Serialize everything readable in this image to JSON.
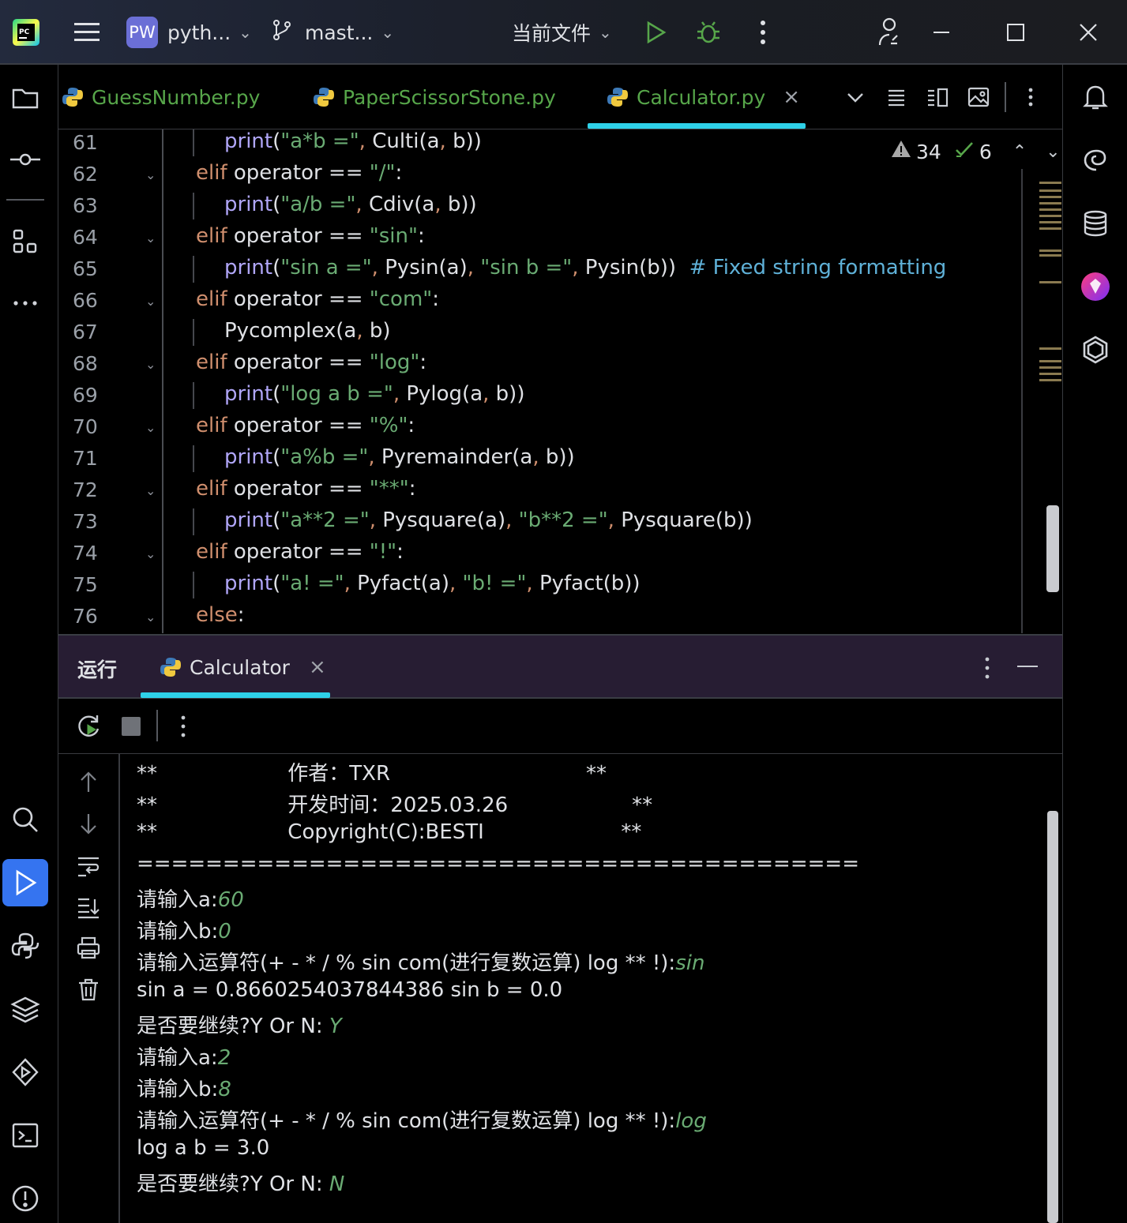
{
  "titlebar": {
    "project_badge": "PW",
    "project_name": "pyth...",
    "branch": "mast...",
    "run_config": "当前文件"
  },
  "tabs": [
    {
      "label": "GuessNumber.py"
    },
    {
      "label": "PaperScissorStone.py"
    },
    {
      "label": "Calculator.py",
      "active": true
    }
  ],
  "editor": {
    "warnings": "34",
    "checks": "6",
    "line_numbers": [
      "61",
      "62",
      "63",
      "64",
      "65",
      "66",
      "67",
      "68",
      "69",
      "70",
      "71",
      "72",
      "73",
      "74",
      "75",
      "76"
    ]
  },
  "run_panel": {
    "title": "运行",
    "tab_label": "Calculator"
  },
  "console": {
    "lines": [
      {
        "text": "**                    作者：TXR                              **"
      },
      {
        "text": "**                    开发时间：2025.03.26                   **"
      },
      {
        "text": "**                    Copyright(C):BESTI                     **"
      },
      {
        "text": "=========================================="
      },
      {
        "text": "请输入a:",
        "input": "60"
      },
      {
        "text": "请输入b:",
        "input": "0"
      },
      {
        "text": "请输入运算符(+ - * / % sin com(进行复数运算) log ** !):",
        "input": "sin"
      },
      {
        "text": "sin a = 0.8660254037844386 sin b = 0.0"
      },
      {
        "text": "是否要继续?Y Or N: ",
        "input": "Y"
      },
      {
        "text": "请输入a:",
        "input": "2"
      },
      {
        "text": "请输入b:",
        "input": "8"
      },
      {
        "text": "请输入运算符(+ - * / % sin com(进行复数运算) log ** !):",
        "input": "log"
      },
      {
        "text": "log a b = 3.0"
      },
      {
        "text": "是否要继续?Y Or N: ",
        "input": "N"
      }
    ]
  },
  "colors": {
    "accent": "#3574f0",
    "tab_underline": "#2ed1e8",
    "string": "#6aab73",
    "keyword": "#cf8e6d",
    "function": "#b0a6f8",
    "comment": "#5fb1d8"
  }
}
